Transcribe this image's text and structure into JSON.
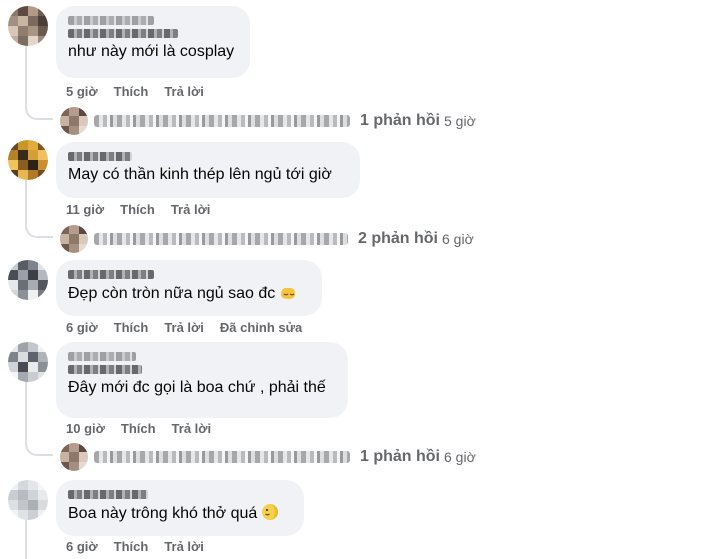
{
  "comments": [
    {
      "text": "như này mới là cosplay",
      "time": "5 giờ",
      "like": "Thích",
      "reply": "Trả lời",
      "replies": {
        "count": "1 phản hồi",
        "time": "5 giờ"
      }
    },
    {
      "text": "May có thần kinh thép lên ngủ tới giờ",
      "time": "11 giờ",
      "like": "Thích",
      "reply": "Trả lời",
      "replies": {
        "count": "2 phản hồi",
        "time": "6 giờ"
      }
    },
    {
      "text": "Đẹp còn tròn nữa ngủ sao đc",
      "emoji": "sleepy-face-emoji",
      "time": "6 giờ",
      "like": "Thích",
      "reply": "Trả lời",
      "edited": "Đã chỉnh sửa"
    },
    {
      "text": "Đây mới đc gọi là boa chứ , phải thế",
      "time": "10 giờ",
      "like": "Thích",
      "reply": "Trả lời",
      "replies": {
        "count": "1 phản hồi",
        "time": "6 giờ"
      }
    },
    {
      "text": "Boa này trông khó thở quá",
      "emoji": "moon-face-emoji",
      "time": "6 giờ",
      "like": "Thích",
      "reply": "Trả lời"
    }
  ],
  "colors": {
    "bubble": "#f0f2f5",
    "meta_text": "#65676b",
    "text": "#050505",
    "thread_line": "#dcdfe3"
  }
}
